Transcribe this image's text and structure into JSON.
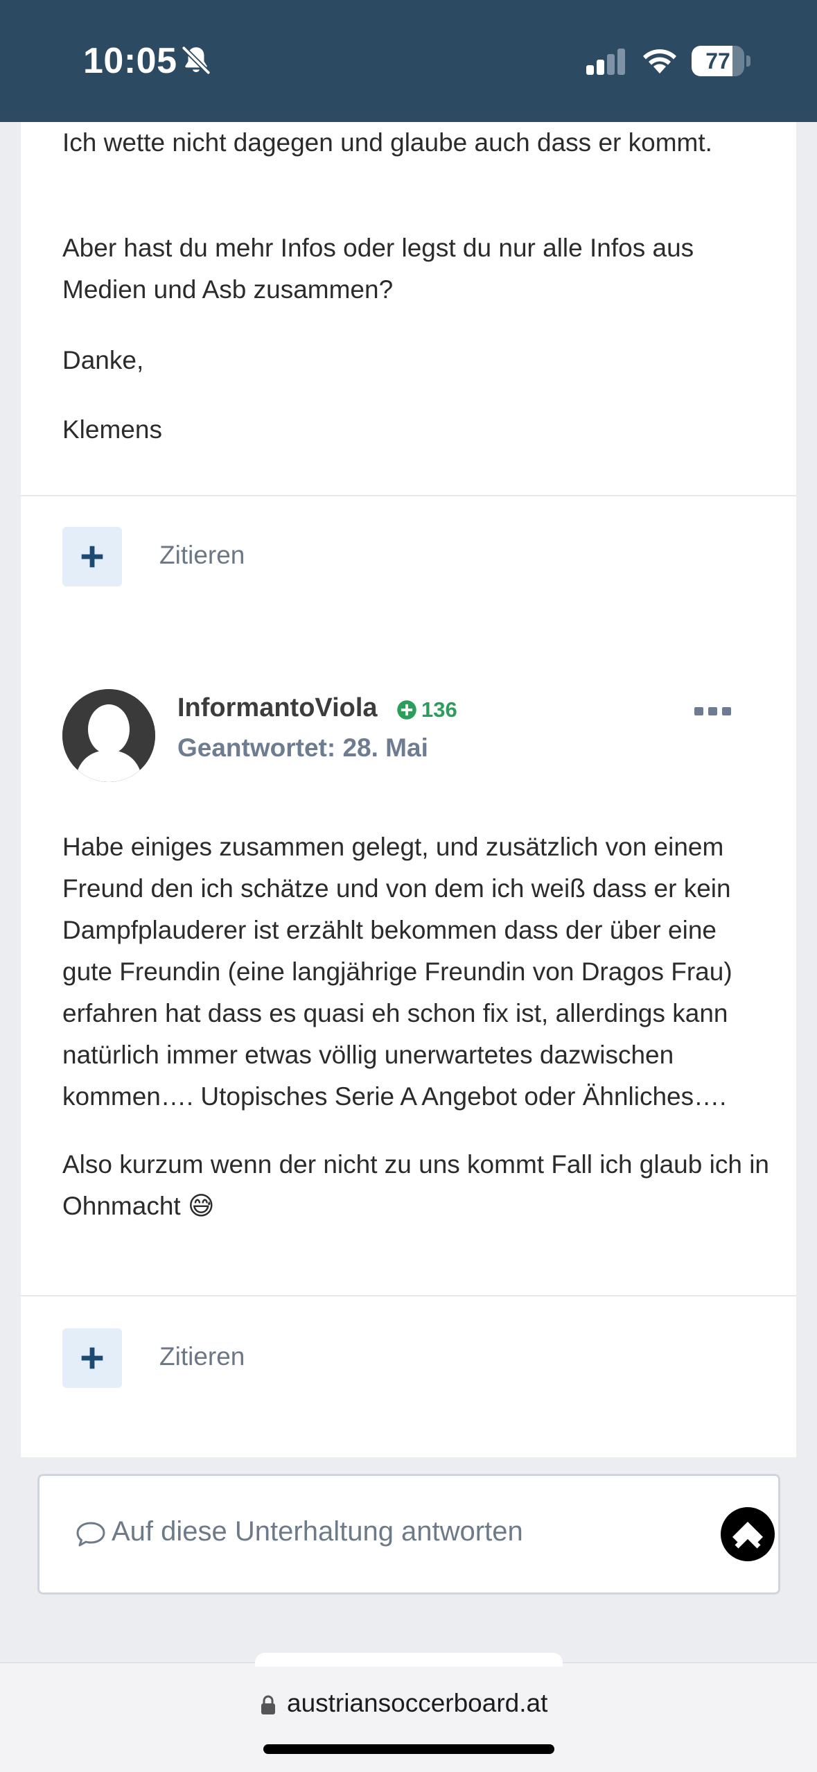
{
  "status_bar": {
    "time": "10:05",
    "battery": "77",
    "battery_level": 0.77
  },
  "previous_post": {
    "paragraphs": [
      "Ich wette nicht dagegen und glaube auch dass er kommt.",
      "Aber hast du mehr Infos oder legst du nur alle Infos aus Medien und Asb zusammen?",
      "Danke,",
      "Klemens"
    ],
    "quote_label": "Zitieren"
  },
  "post": {
    "author": "InformantoViola",
    "reputation": "136",
    "date": "Geantwortet: 28. Mai",
    "paragraphs": [
      "Habe einiges zusammen gelegt, und zusätzlich von einem Freund den ich schätze und von dem ich weiß dass er kein Dampfplauderer ist erzählt bekommen dass der über eine gute Freundin (eine langjährige Freundin von Dragos Frau) erfahren hat dass es quasi eh schon fix ist, allerdings kann natürlich immer etwas völlig unerwartetes dazwischen kommen…. Utopisches Serie A Angebot oder Ähnliches….",
      "Also kurzum wenn der nicht zu uns kommt Fall ich glaub ich in Ohnmacht 😅"
    ],
    "quote_label": "Zitieren"
  },
  "reply": {
    "label": "Auf diese Unterhaltung antworten"
  },
  "browser": {
    "url": "austriansoccerboard.at"
  },
  "colors": {
    "header_bg": "#2d4a63",
    "reputation_green": "#2c9e5c",
    "quote_button_bg": "#e3eef8"
  }
}
